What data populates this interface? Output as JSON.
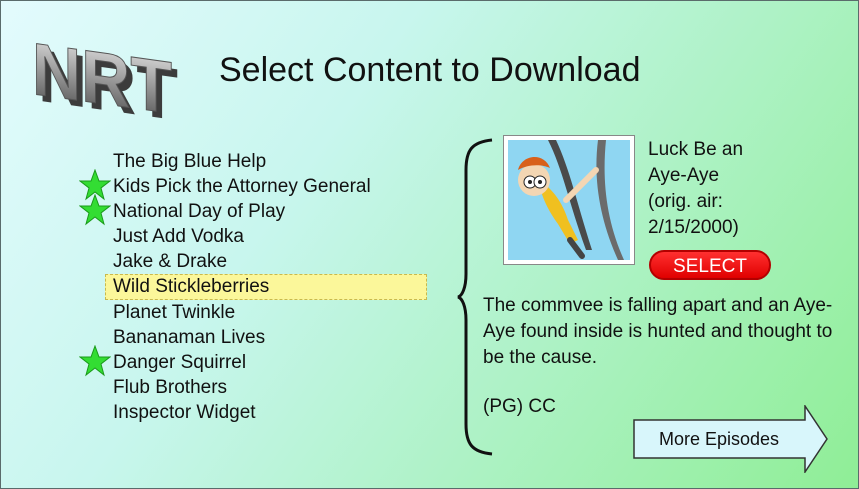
{
  "header": {
    "title": "Select Content to Download",
    "logo_text": "NRT"
  },
  "list": {
    "items": [
      {
        "label": "The Big Blue Help",
        "starred": false,
        "selected": false
      },
      {
        "label": "Kids Pick the Attorney General",
        "starred": true,
        "selected": false
      },
      {
        "label": "National Day of Play",
        "starred": true,
        "selected": false
      },
      {
        "label": "Just Add Vodka",
        "starred": false,
        "selected": false
      },
      {
        "label": "Jake & Drake",
        "starred": false,
        "selected": false
      },
      {
        "label": "Wild Stickleberries",
        "starred": false,
        "selected": true
      },
      {
        "label": "Planet Twinkle",
        "starred": false,
        "selected": false
      },
      {
        "label": "Bananaman Lives",
        "starred": false,
        "selected": false
      },
      {
        "label": "Danger Squirrel",
        "starred": true,
        "selected": false
      },
      {
        "label": "Flub Brothers",
        "starred": false,
        "selected": false
      },
      {
        "label": "Inspector Widget",
        "starred": false,
        "selected": false
      }
    ]
  },
  "episode": {
    "title_lines": [
      "Luck Be an",
      "Aye-Aye",
      "(orig. air:",
      "2/15/2000)"
    ],
    "select_label": "SELECT",
    "description": "The commvee is falling apart and an Aye-Aye found inside is hunted and thought to be the cause.",
    "rating": "(PG) CC"
  },
  "more_button": {
    "label": "More Episodes"
  },
  "colors": {
    "star": "#33dd33",
    "select_button": "#ee0000",
    "selected_row": "#fbf79a",
    "more_button_fill": "#d8f6fb"
  }
}
